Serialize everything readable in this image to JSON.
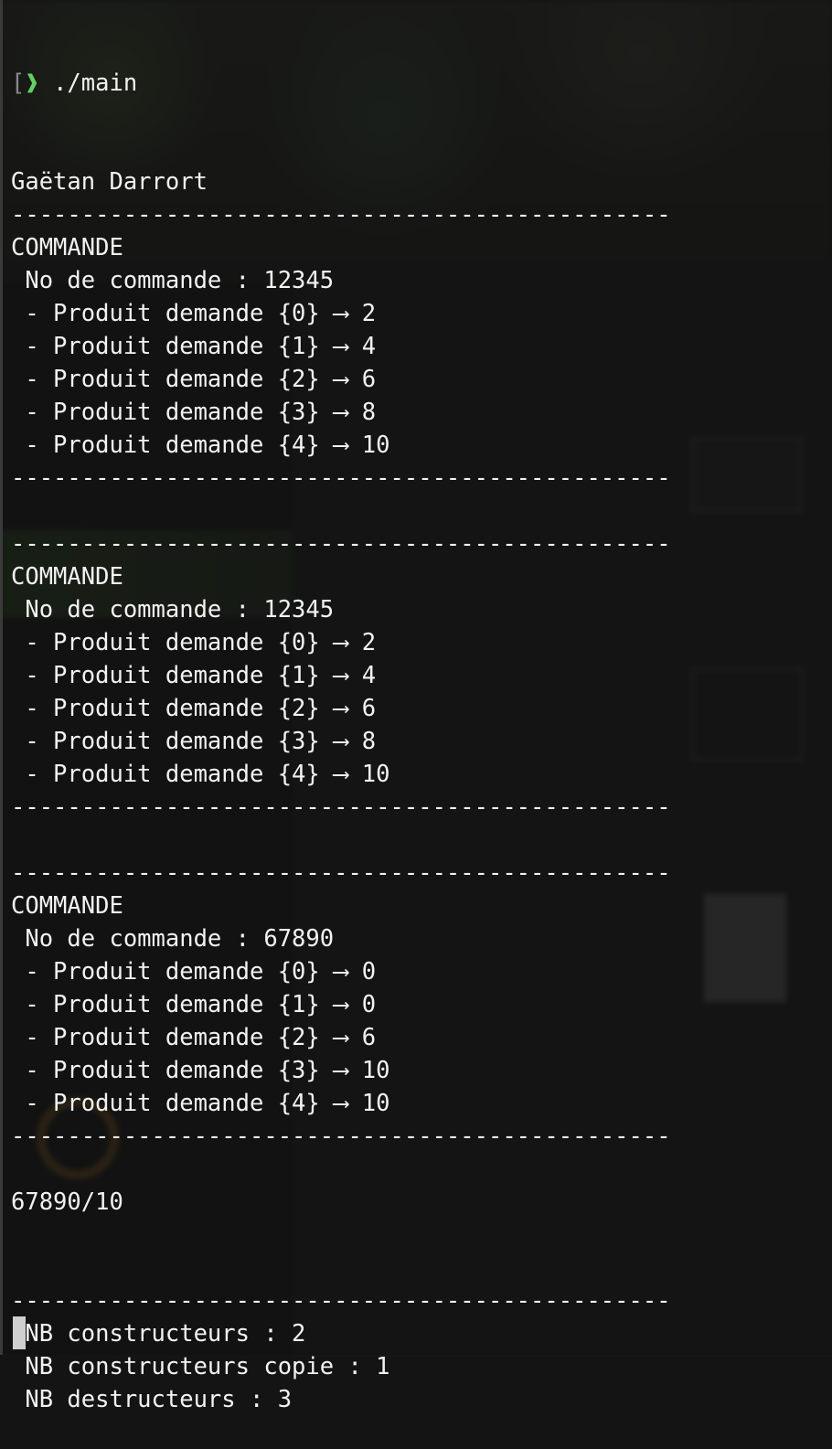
{
  "prompt": {
    "bracket": "[",
    "symbol": "❱",
    "command": " ./main"
  },
  "lines": [
    "Gaëtan Darrort",
    "-----------------------------------------------",
    "COMMANDE",
    " No de commande : 12345",
    " - Produit demande {0} ⟶ 2",
    " - Produit demande {1} ⟶ 4",
    " - Produit demande {2} ⟶ 6",
    " - Produit demande {3} ⟶ 8",
    " - Produit demande {4} ⟶ 10",
    "-----------------------------------------------",
    "",
    "-----------------------------------------------",
    "COMMANDE",
    " No de commande : 12345",
    " - Produit demande {0} ⟶ 2",
    " - Produit demande {1} ⟶ 4",
    " - Produit demande {2} ⟶ 6",
    " - Produit demande {3} ⟶ 8",
    " - Produit demande {4} ⟶ 10",
    "-----------------------------------------------",
    "",
    "-----------------------------------------------",
    "COMMANDE",
    " No de commande : 67890",
    " - Produit demande {0} ⟶ 0",
    " - Produit demande {1} ⟶ 0",
    " - Produit demande {2} ⟶ 6",
    " - Produit demande {3} ⟶ 10",
    " - Produit demande {4} ⟶ 10",
    "-----------------------------------------------",
    "",
    "67890/10",
    "",
    "",
    "-----------------------------------------------",
    " NB constructeurs : 2",
    " NB constructeurs copie : 1",
    " NB destructeurs : 3"
  ],
  "colors": {
    "text": "#f2f2f2",
    "prompt_symbol": "#5fd35f",
    "background": "#141414"
  }
}
